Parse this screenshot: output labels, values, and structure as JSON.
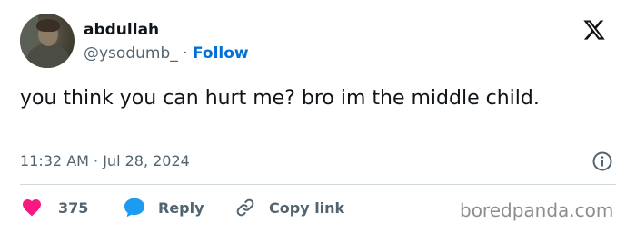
{
  "author": {
    "name": "abdullah",
    "handle": "@ysodumb_",
    "separator": "·",
    "follow_label": "Follow"
  },
  "tweet": {
    "text": "you think you can hurt me? bro im the middle child.",
    "timestamp": "11:32 AM · Jul 28, 2024"
  },
  "actions": {
    "like_count": "375",
    "reply_label": "Reply",
    "copy_label": "Copy link"
  },
  "icons": {
    "like": "heart-icon",
    "reply": "speech-bubble-icon",
    "copy": "link-icon",
    "info": "info-icon",
    "platform": "x-logo-icon"
  },
  "colors": {
    "heart": "#f91880",
    "reply_bubble": "#1d9bf0",
    "follow": "#006fd6",
    "secondary_text": "#536471"
  },
  "watermark": "boredpanda.com"
}
